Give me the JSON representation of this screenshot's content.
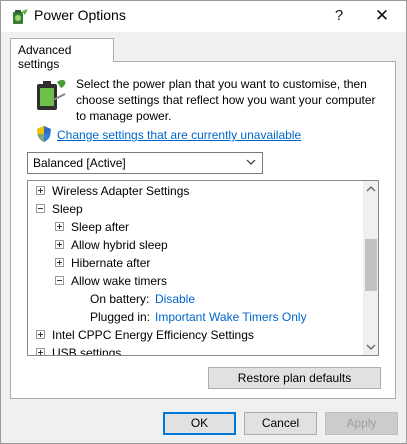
{
  "window": {
    "title": "Power Options",
    "help_glyph": "?",
    "close_glyph": "✕"
  },
  "tab": {
    "label": "Advanced settings"
  },
  "intro": {
    "text": "Select the power plan that you want to customise, then\nchoose settings that reflect how you want your computer\nto manage power.",
    "change_link": "Change settings that are currently unavailable"
  },
  "plan_select": {
    "value": "Balanced [Active]"
  },
  "tree": {
    "rows": [
      {
        "label": "Wireless Adapter Settings",
        "expander": "plus"
      },
      {
        "label": "Sleep",
        "expander": "minus"
      },
      {
        "label": "Sleep after",
        "expander": "plus"
      },
      {
        "label": "Allow hybrid sleep",
        "expander": "plus"
      },
      {
        "label": "Hibernate after",
        "expander": "plus"
      },
      {
        "label": "Allow wake timers",
        "expander": "minus"
      },
      {
        "label": "On battery:",
        "value": "Disable"
      },
      {
        "label": "Plugged in:",
        "value": "Important Wake Timers Only"
      },
      {
        "label": "Intel CPPC Energy Efficiency Settings",
        "expander": "plus"
      },
      {
        "label": "USB settings",
        "expander": "plus"
      }
    ]
  },
  "buttons": {
    "restore": "Restore plan defaults",
    "ok": "OK",
    "cancel": "Cancel",
    "apply": "Apply"
  },
  "colors": {
    "link": "#0066cc",
    "accent": "#0078d7"
  }
}
